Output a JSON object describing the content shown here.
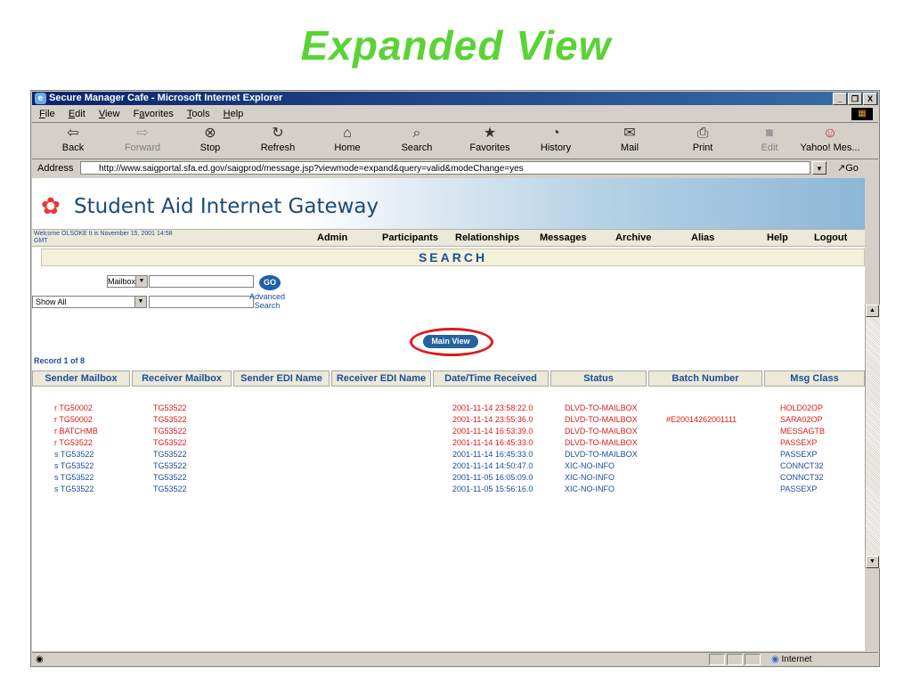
{
  "slide": {
    "title": "Expanded View"
  },
  "window": {
    "title": "Secure Manager Cafe - Microsoft Internet Explorer",
    "icon": "ie-icon",
    "controls": [
      "_",
      "❐",
      "X"
    ]
  },
  "menubar": [
    {
      "pre": "",
      "u": "F",
      "post": "ile"
    },
    {
      "pre": "",
      "u": "E",
      "post": "dit"
    },
    {
      "pre": "",
      "u": "V",
      "post": "iew"
    },
    {
      "pre": "F",
      "u": "a",
      "post": "vorites"
    },
    {
      "pre": "",
      "u": "T",
      "post": "ools"
    },
    {
      "pre": "",
      "u": "H",
      "post": "elp"
    }
  ],
  "toolbar": [
    {
      "label": "Back",
      "icon": "back-arrow-icon",
      "glyph": "⇦",
      "enabled": true
    },
    {
      "label": "Forward",
      "icon": "forward-arrow-icon",
      "glyph": "⇨",
      "enabled": false
    },
    {
      "label": "Stop",
      "icon": "stop-icon",
      "glyph": "⊗",
      "enabled": true
    },
    {
      "label": "Refresh",
      "icon": "refresh-icon",
      "glyph": "↻",
      "enabled": true
    },
    {
      "label": "Home",
      "icon": "home-icon",
      "glyph": "⌂",
      "enabled": true
    },
    {
      "label": "Search",
      "icon": "search-icon",
      "glyph": "⌕",
      "enabled": true
    },
    {
      "label": "Favorites",
      "icon": "favorites-icon",
      "glyph": "★",
      "enabled": true
    },
    {
      "label": "History",
      "icon": "history-icon",
      "glyph": "◔",
      "enabled": true
    },
    {
      "label": "Mail",
      "icon": "mail-icon",
      "glyph": "✉",
      "enabled": true
    },
    {
      "label": "Print",
      "icon": "print-icon",
      "glyph": "⎙",
      "enabled": true
    },
    {
      "label": "Edit",
      "icon": "edit-icon",
      "glyph": "■",
      "enabled": false
    },
    {
      "label": "Yahoo! Mes...",
      "icon": "yahoo-messenger-icon",
      "glyph": "☺",
      "enabled": true
    }
  ],
  "address": {
    "label": "Address",
    "url": "http://www.saigportal.sfa.ed.gov/saigprod/message.jsp?viewmode=expand&query=valid&modeChange=yes",
    "go_label": "Go"
  },
  "site": {
    "name": "Student Aid Internet Gateway",
    "welcome_line1": "Welcome OLSOKE    It is November 15, 2001 14:58",
    "welcome_line2": "GMT",
    "nav": [
      "Admin",
      "Participants",
      "Relationships",
      "Messages",
      "Archive",
      "Alias",
      "Help",
      "Logout"
    ]
  },
  "search": {
    "heading": "SEARCH",
    "mailbox_select": "Mailbox",
    "show_select": "Show All",
    "mailbox_value": "",
    "show_value": "",
    "go_label": "GO",
    "advanced_line1": "Advanced",
    "advanced_line2": "Search"
  },
  "main_view_button": "Main View",
  "record_info": "Record 1 of 8",
  "table": {
    "headers": [
      "Sender Mailbox",
      "Receiver Mailbox",
      "Sender EDI Name",
      "Receiver EDI Name",
      "Date/Time Received",
      "Status",
      "Batch Number",
      "Msg Class"
    ],
    "rows": [
      {
        "color": "red",
        "sender": "r TG50002",
        "receiver": "TG53522",
        "sender_edi": "",
        "receiver_edi": "",
        "datetime": "2001-11-14 23:58:22.0",
        "status": "DLVD-TO-MAILBOX",
        "batch": "",
        "msg_class": "HOLD02OP"
      },
      {
        "color": "red",
        "sender": "r TG50002",
        "receiver": "TG53522",
        "sender_edi": "",
        "receiver_edi": "",
        "datetime": "2001-11-14 23:55:36.0",
        "status": "DLVD-TO-MAILBOX",
        "batch": "#E20014262001111",
        "msg_class": "SARA02OP"
      },
      {
        "color": "red",
        "sender": "r BATCHMB",
        "receiver": "TG53522",
        "sender_edi": "",
        "receiver_edi": "",
        "datetime": "2001-11-14 16:53:39.0",
        "status": "DLVD-TO-MAILBOX",
        "batch": "",
        "msg_class": "MESSAGTB"
      },
      {
        "color": "red",
        "sender": "r TG53522",
        "receiver": "TG53522",
        "sender_edi": "",
        "receiver_edi": "",
        "datetime": "2001-11-14 16:45:33.0",
        "status": "DLVD-TO-MAILBOX",
        "batch": "",
        "msg_class": "PASSEXP"
      },
      {
        "color": "blue",
        "sender": "s TG53522",
        "receiver": "TG53522",
        "sender_edi": "",
        "receiver_edi": "",
        "datetime": "2001-11-14 16:45:33.0",
        "status": "DLVD-TO-MAILBOX",
        "batch": "",
        "msg_class": "PASSEXP"
      },
      {
        "color": "blue",
        "sender": "s TG53522",
        "receiver": "TG53522",
        "sender_edi": "",
        "receiver_edi": "",
        "datetime": "2001-11-14 14:50:47.0",
        "status": "XIC-NO-INFO",
        "batch": "",
        "msg_class": "CONNCT32"
      },
      {
        "color": "blue",
        "sender": "s TG53522",
        "receiver": "TG53522",
        "sender_edi": "",
        "receiver_edi": "",
        "datetime": "2001-11-05 16:05:09.0",
        "status": "XIC-NO-INFO",
        "batch": "",
        "msg_class": "CONNCT32"
      },
      {
        "color": "blue",
        "sender": "s TG53522",
        "receiver": "TG53522",
        "sender_edi": "",
        "receiver_edi": "",
        "datetime": "2001-11-05 15:56:16.0",
        "status": "XIC-NO-INFO",
        "batch": "",
        "msg_class": "PASSEXP"
      }
    ]
  },
  "statusbar": {
    "zone": "Internet"
  },
  "colors": {
    "accent_green": "#5ad336",
    "sent_blue": "#1b4a9e",
    "received_red": "#dd1a1a",
    "highlight_circle": "#dd1a1a"
  }
}
